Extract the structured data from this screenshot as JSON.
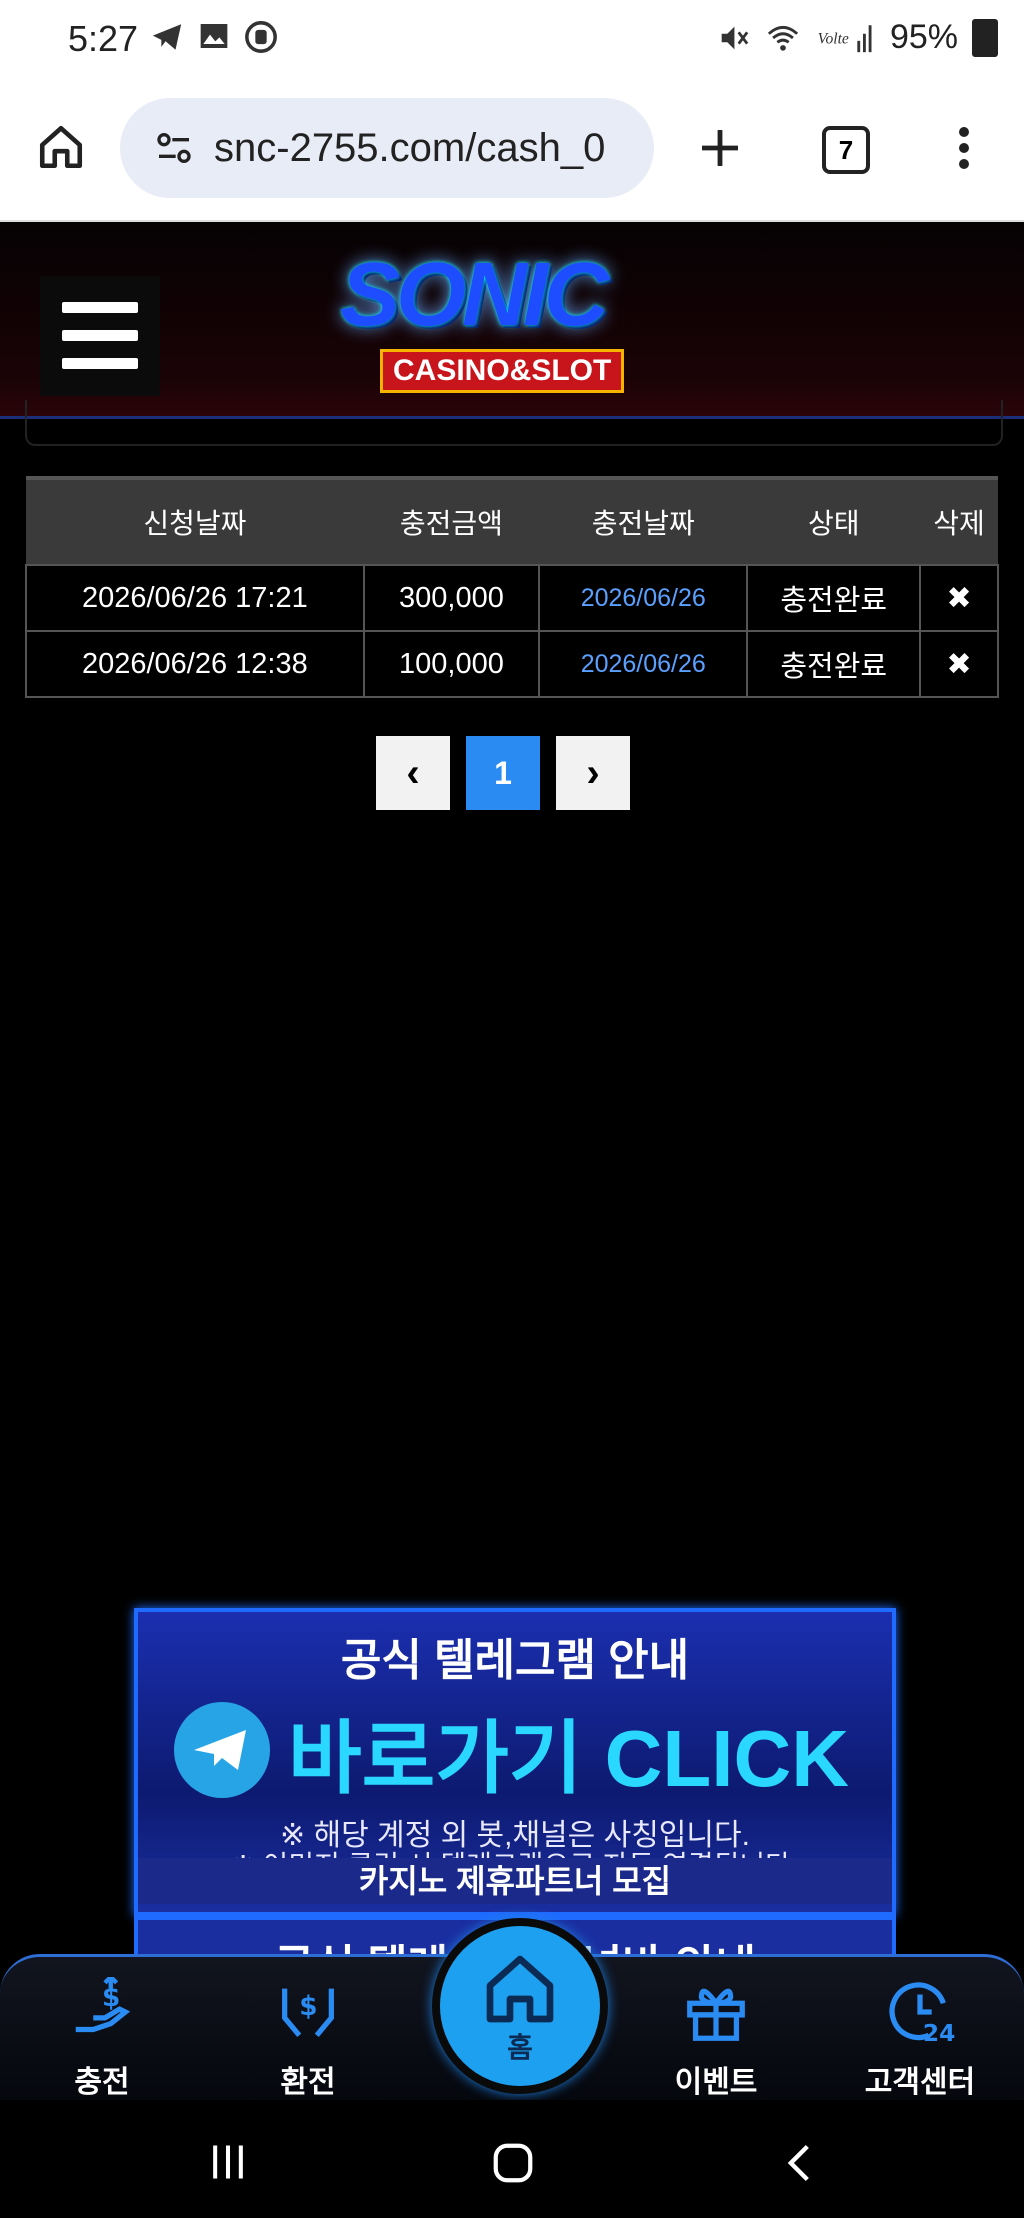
{
  "status_bar": {
    "time": "5:27",
    "battery": "95%"
  },
  "browser": {
    "url": "snc-2755.com/cash_0",
    "tab_count": "7"
  },
  "site": {
    "logo_main": "SONIC",
    "logo_sub": "CASINO&SLOT"
  },
  "table": {
    "headers": [
      "신청날짜",
      "충전금액",
      "충전날짜",
      "상태",
      "삭제"
    ],
    "rows": [
      {
        "request_date": "2026/06/26 17:21",
        "amount": "300,000",
        "charge_date": "2026/06/26",
        "status": "충전완료",
        "delete": "✖"
      },
      {
        "request_date": "2026/06/26 12:38",
        "amount": "100,000",
        "charge_date": "2026/06/26",
        "status": "충전완료",
        "delete": "✖"
      }
    ]
  },
  "pagination": {
    "prev": "‹",
    "current": "1",
    "next": "›"
  },
  "banner": {
    "title": "공식 텔레그램 안내",
    "cta": "바로가기 CLICK",
    "note1": "※ 해당 계정 외 봇,채널은 사칭입니다.",
    "note2": "※ 이미지 클릭 시 텔레그램으로 자동 연결됩니다.",
    "footer": "카지노 제휴파트너 모집"
  },
  "banner2": {
    "title": "공식 텔레그램 채널바 안내"
  },
  "bottom_nav": {
    "charge": "충전",
    "exchange": "환전",
    "home": "홈",
    "event": "이벤트",
    "support": "고객센터"
  }
}
